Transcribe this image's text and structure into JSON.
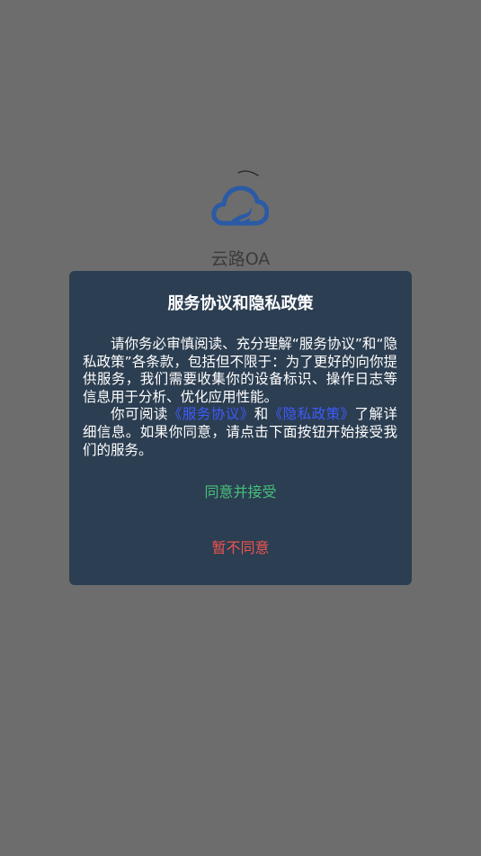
{
  "splash": {
    "app_name": "云路OA",
    "logo_icon": "cloud-road-logo",
    "loader_icon": "loading-spinner"
  },
  "dialog": {
    "title": "服务协议和隐私政策",
    "para1": "请你务必审慎阅读、充分理解“服务协议”和“隐私政策”各条款，包括但不限于：为了更好的向你提供服务，我们需要收集你的设备标识、操作日志等信息用于分析、优化应用性能。",
    "para2_prefix": "你可阅读",
    "service_link": "《服务协议》",
    "para2_and": "和",
    "privacy_link": "《隐私政策》",
    "para2_suffix": "了解详细信息。如果你同意，请点击下面按钮开始接受我们的服务。",
    "agree_label": "同意并接受",
    "decline_label": "暂不同意"
  },
  "colors": {
    "overlay": "#6d6d6d",
    "dialog_bg": "#2c3e51",
    "logo_blue": "#2b5aa6",
    "link": "#3d5bff",
    "agree": "#46c07b",
    "decline": "#ef5350"
  }
}
